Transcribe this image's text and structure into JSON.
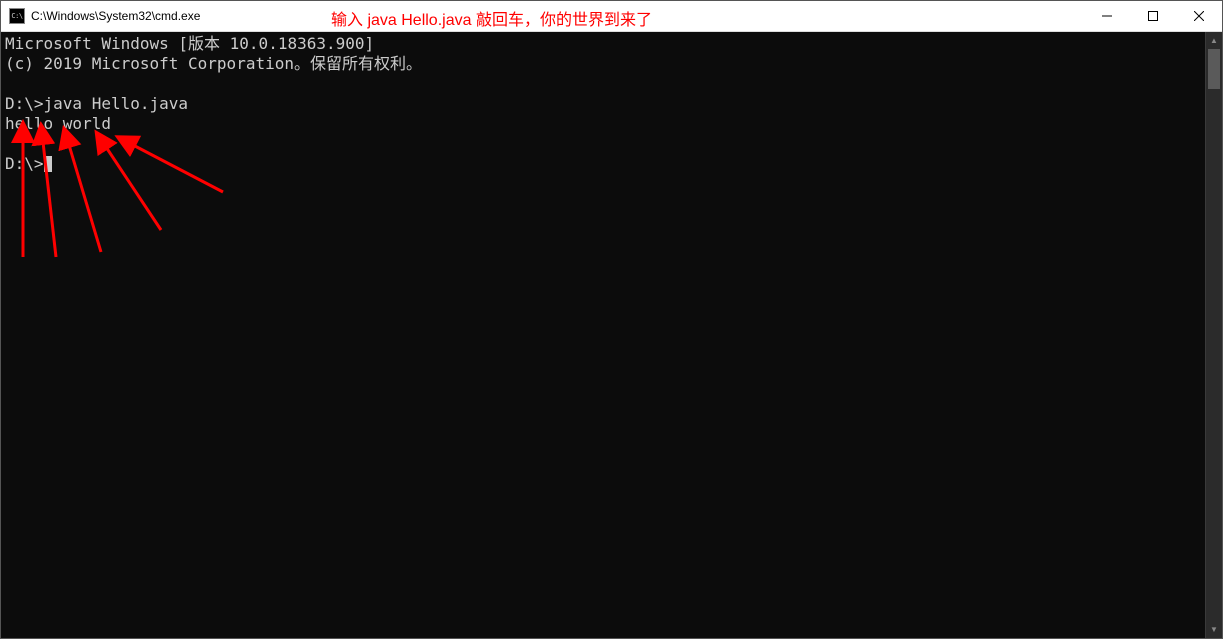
{
  "titlebar": {
    "icon_text": "C:\\",
    "title": "C:\\Windows\\System32\\cmd.exe",
    "annotation": "输入 java Hello.java 敲回车，你的世界到来了"
  },
  "terminal": {
    "line1": "Microsoft Windows [版本 10.0.18363.900]",
    "line2": "(c) 2019 Microsoft Corporation。保留所有权利。",
    "line3": "",
    "line4": "D:\\>java Hello.java",
    "line5": "hello world",
    "line6": "",
    "line7_prompt": "D:\\>"
  },
  "annotation_color": "#ff0000"
}
